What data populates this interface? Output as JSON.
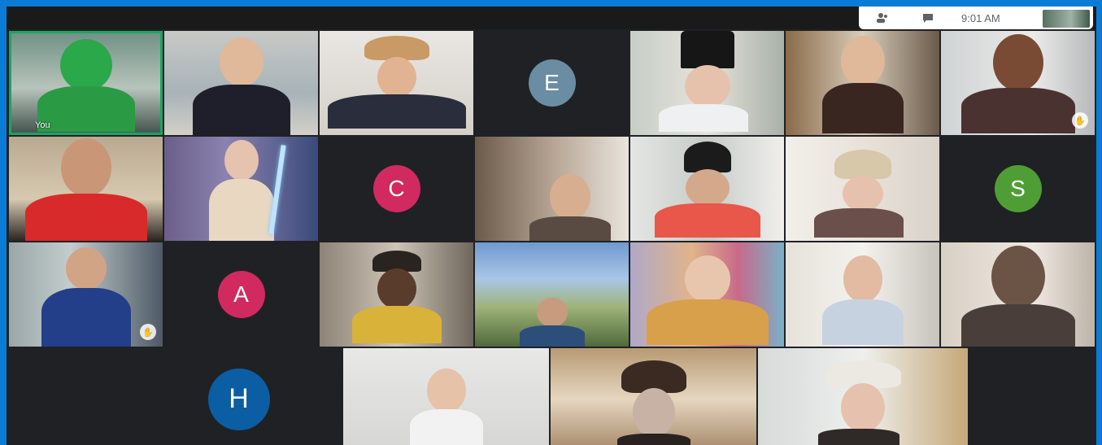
{
  "system_bar": {
    "time": "9:01 AM",
    "icons": [
      "people-icon",
      "chat-icon"
    ]
  },
  "self_label": "You",
  "avatars": [
    {
      "letter": "E",
      "color": "#6b8da3"
    },
    {
      "letter": "C",
      "color": "#d12a60"
    },
    {
      "letter": "S",
      "color": "#4f9e35"
    },
    {
      "letter": "A",
      "color": "#d12a60"
    },
    {
      "letter": "H",
      "color": "#0b5ea3"
    }
  ]
}
